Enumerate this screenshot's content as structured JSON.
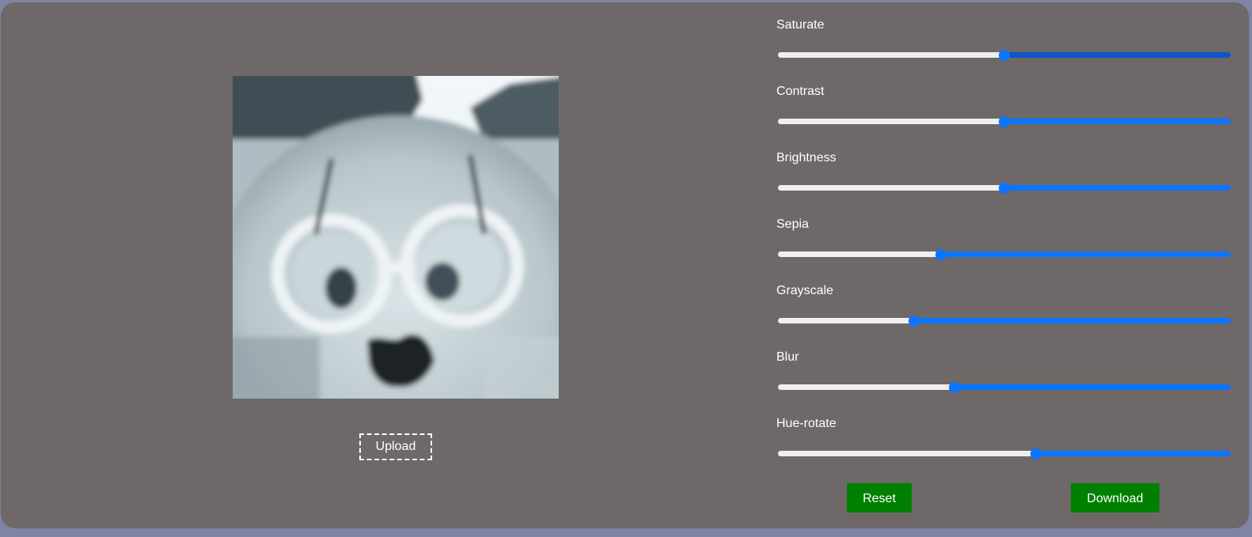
{
  "upload": {
    "label": "Upload"
  },
  "controls": [
    {
      "label": "Saturate",
      "value": 0.5
    },
    {
      "label": "Contrast",
      "value": 0.5
    },
    {
      "label": "Brightness",
      "value": 0.5
    },
    {
      "label": "Sepia",
      "value": 0.36
    },
    {
      "label": "Grayscale",
      "value": 0.3
    },
    {
      "label": "Blur",
      "value": 0.39
    },
    {
      "label": "Hue-rotate",
      "value": 0.57
    }
  ],
  "actions": {
    "reset_label": "Reset",
    "download_label": "Download"
  },
  "colors": {
    "panel": "#6e6868",
    "page_background": "#8084a4",
    "slider_fill": "#0a75ff",
    "slider_track": "#efefef",
    "button_green": "#008000"
  }
}
